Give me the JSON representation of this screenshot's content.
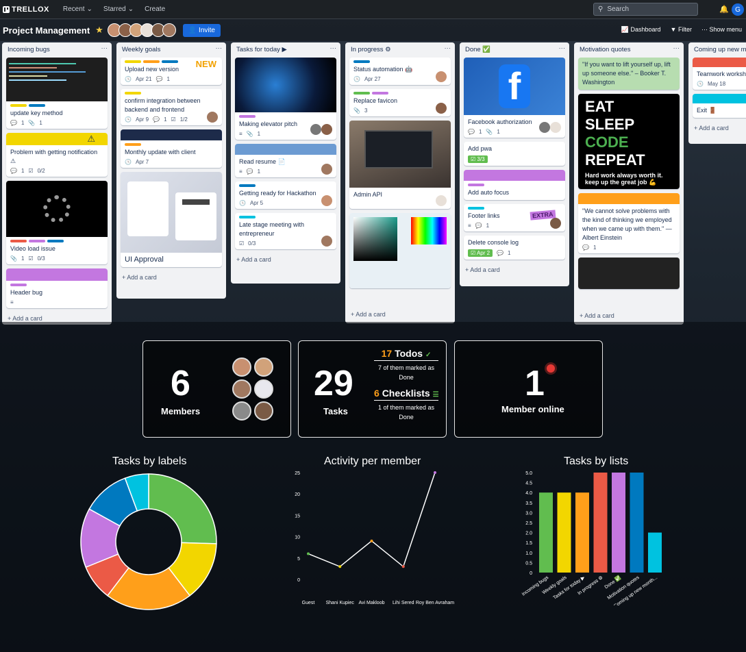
{
  "topbar": {
    "logo": "TRELLOX",
    "recent": "Recent",
    "starred": "Starred",
    "create": "Create",
    "search_placeholder": "Search",
    "user_initial": "G"
  },
  "board": {
    "title": "Project Management",
    "invite": "Invite",
    "dashboard": "Dashboard",
    "filter": "Filter",
    "show_menu": "Show menu"
  },
  "lists": [
    {
      "title": "Incoming bugs",
      "add": "Add a card",
      "cards": [
        {
          "title": "update key method",
          "meta": [
            "1",
            "1"
          ]
        },
        {
          "title": "Problem with getting notification ⚠",
          "meta": [
            "1",
            "0/2"
          ]
        },
        {
          "title": "Video load issue",
          "meta": [
            "1",
            "0/3"
          ]
        },
        {
          "title": "Header bug",
          "meta": []
        }
      ]
    },
    {
      "title": "Weekly goals",
      "add": "Add a card",
      "cards": [
        {
          "title": "Upload new version",
          "meta": [
            "Apr 21",
            "1"
          ],
          "badge": "NEW"
        },
        {
          "title": "confirm integration between backend and frontend",
          "meta": [
            "Apr 9",
            "1",
            "1/2"
          ]
        },
        {
          "title": "Monthly update with client",
          "meta": [
            "Apr 7"
          ]
        },
        {
          "title": "UI Approval",
          "meta": []
        }
      ]
    },
    {
      "title": "Tasks for today ▶",
      "add": "Add a card",
      "cards": [
        {
          "title": "Making elevator pitch",
          "meta": [
            "1"
          ]
        },
        {
          "title": "Read resume 📄",
          "meta": [
            "1"
          ]
        },
        {
          "title": "Getting ready for Hackathon",
          "meta": [
            "Apr 5"
          ]
        },
        {
          "title": "Late stage meeting with entrepreneur",
          "meta": [
            "0/3"
          ]
        }
      ]
    },
    {
      "title": "In progress ⚙",
      "add": "Add a card",
      "cards": [
        {
          "title": "Status automation 🤖",
          "meta": [
            "Apr 27"
          ]
        },
        {
          "title": "Replace favicon",
          "meta": [
            "3"
          ]
        },
        {
          "title": "Admin API",
          "meta": []
        },
        {
          "title": "",
          "meta": []
        }
      ]
    },
    {
      "title": "Done ✅",
      "add": "Add a card",
      "cards": [
        {
          "title": "Facebook authorization",
          "meta": [
            "1",
            "1"
          ]
        },
        {
          "title": "Add pwa",
          "meta": [
            "3/3"
          ]
        },
        {
          "title": "Add auto focus",
          "meta": []
        },
        {
          "title": "Footer links",
          "meta": [
            "1"
          ],
          "badge": "EXTRA"
        },
        {
          "title": "Delete console log",
          "meta": [
            "Apr 2",
            "1"
          ]
        }
      ]
    },
    {
      "title": "Motivation quotes",
      "add": "Add a card",
      "cards": [
        {
          "title": "\"If you want to lift yourself up, lift up someone else.\" – Booker T. Washington",
          "meta": []
        },
        {
          "title": "Hard work always worth it. keep up the great job 💪",
          "poster": [
            "EAT",
            "SLEEP",
            "CODE",
            "REPEAT"
          ],
          "meta": []
        },
        {
          "title": "\"We cannot solve problems with the kind of thinking we employed when we came up with them.\" — Albert Einstein",
          "meta": [
            "1"
          ]
        }
      ]
    },
    {
      "title": "Coming up new mon",
      "add": "Add a card",
      "cards": [
        {
          "title": "Teamwork workshop 👥🎯",
          "meta": [
            "May 18"
          ]
        },
        {
          "title": "Exit 🚪",
          "meta": []
        }
      ]
    }
  ],
  "stats": {
    "members": {
      "value": "6",
      "label": "Members"
    },
    "tasks": {
      "value": "29",
      "label": "Tasks",
      "todos_n": "17",
      "todos_label": "Todos",
      "todos_sub": "7 of them marked as Done",
      "check_n": "6",
      "check_label": "Checklists",
      "check_sub": "1 of them marked as Done"
    },
    "online": {
      "value": "1",
      "label": "Member online"
    }
  },
  "chart_titles": {
    "labels": "Tasks by labels",
    "activity": "Activity per member",
    "lists": "Tasks by lists"
  },
  "chart_data": [
    {
      "type": "pie",
      "title": "Tasks by labels",
      "values": [
        27,
        15,
        22,
        9,
        15,
        12,
        6
      ],
      "colors": [
        "#61bd4f",
        "#f2d600",
        "#ff9f1a",
        "#eb5a46",
        "#c377e0",
        "#0079bf",
        "#00c2e0"
      ]
    },
    {
      "type": "line",
      "title": "Activity per member",
      "categories": [
        "Guest",
        "Shani Kupiec",
        "Avi Makloob",
        "Lihi Sered",
        "Roy Ben Avraham"
      ],
      "values": [
        6,
        3,
        9,
        3,
        25
      ],
      "ylim": [
        0,
        25
      ],
      "yticks": [
        0,
        5,
        10,
        15,
        20,
        25
      ]
    },
    {
      "type": "bar",
      "title": "Tasks by lists",
      "categories": [
        "Incoming bugs",
        "Weekly goals",
        "Tasks for today ▶",
        "In progress ⚙",
        "Done ✅",
        "Motivation quotes",
        "Coming up new month..."
      ],
      "values": [
        4,
        4,
        4,
        5,
        5,
        5,
        2
      ],
      "colors": [
        "#61bd4f",
        "#f2d600",
        "#ff9f1a",
        "#eb5a46",
        "#c377e0",
        "#0079bf",
        "#00c2e0"
      ],
      "ylim": [
        0,
        5
      ],
      "yticks": [
        "0",
        "0.5",
        "1.0",
        "1.5",
        "2.0",
        "2.5",
        "3.0",
        "3.5",
        "4.0",
        "4.5",
        "5.0"
      ]
    }
  ]
}
